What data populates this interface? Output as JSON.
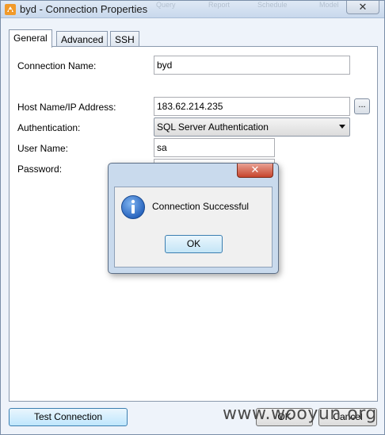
{
  "window": {
    "title": "byd - Connection Properties",
    "close_glyph": "✕",
    "background_menu": [
      "Query",
      "Report",
      "Schedule",
      "Model"
    ]
  },
  "tabs": [
    {
      "label": "General",
      "active": true
    },
    {
      "label": "Advanced",
      "active": false
    },
    {
      "label": "SSH",
      "active": false
    }
  ],
  "form": {
    "connection_name_label": "Connection Name:",
    "connection_name_value": "byd",
    "host_label": "Host Name/IP Address:",
    "host_value": "183.62.214.235",
    "browse_label": "...",
    "auth_label": "Authentication:",
    "auth_value": "SQL Server Authentication",
    "user_label": "User Name:",
    "user_value": "sa",
    "password_label": "Password:"
  },
  "buttons": {
    "test_connection": "Test Connection",
    "ok": "OK",
    "cancel": "Cancel"
  },
  "watermark": "www.wooyun.org",
  "dialog": {
    "message": "Connection Successful",
    "ok_label": "OK",
    "close_glyph": "✕",
    "icon": "info-icon"
  },
  "colors": {
    "accent": "#3c7fb1",
    "info_blue": "#1e5bb8",
    "close_red": "#c7452d"
  }
}
